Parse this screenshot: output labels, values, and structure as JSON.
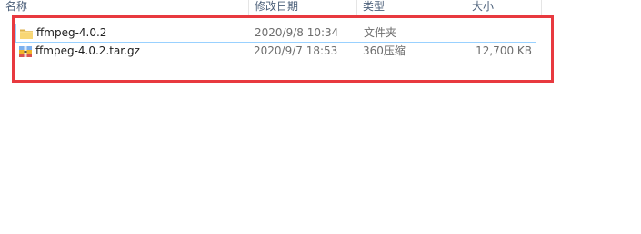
{
  "columns": {
    "name": "名称",
    "date": "修改日期",
    "type": "类型",
    "size": "大小"
  },
  "files": [
    {
      "icon": "folder-icon",
      "name": "ffmpeg-4.0.2",
      "date": "2020/9/8 10:34",
      "type": "文件夹",
      "size": "",
      "selected": true
    },
    {
      "icon": "archive-icon",
      "name": "ffmpeg-4.0.2.tar.gz",
      "date": "2020/9/7 18:53",
      "type": "360压缩",
      "size": "12,700 KB",
      "selected": false
    }
  ],
  "colors": {
    "highlight_border": "#e8393f",
    "selection_border": "#99d1ff",
    "header_text": "#4c607a"
  }
}
